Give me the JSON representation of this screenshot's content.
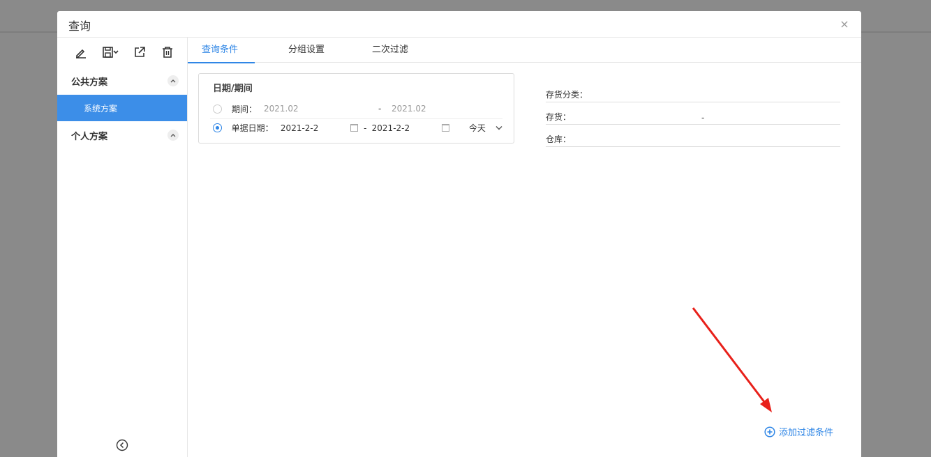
{
  "dialog": {
    "title": "查询",
    "close": "×"
  },
  "sidebar": {
    "toolbar": [
      "edit-icon",
      "save-icon",
      "export-icon",
      "delete-icon"
    ],
    "groups": [
      {
        "label": "公共方案",
        "items": [
          "系统方案"
        ]
      },
      {
        "label": "个人方案",
        "items": []
      }
    ]
  },
  "tabs": [
    "查询条件",
    "分组设置",
    "二次过滤"
  ],
  "date_section": {
    "title": "日期/期间",
    "period": {
      "label": "期间：",
      "from": "2021.02",
      "sep": "-",
      "to": "2021.02"
    },
    "bill_date": {
      "label": "单据日期：",
      "from": "2021-2-2",
      "sep": "-",
      "to": "2021-2-2",
      "preset": "今天"
    }
  },
  "filters": {
    "category_label": "存货分类：",
    "stock_label": "存货：",
    "stock_sep": "-",
    "warehouse_label": "仓库："
  },
  "add_filter": "添加过滤条件",
  "colors": {
    "accent": "#2f86e6",
    "selected_bg": "#3c8ee8",
    "annotation_arrow": "#e8201a"
  }
}
